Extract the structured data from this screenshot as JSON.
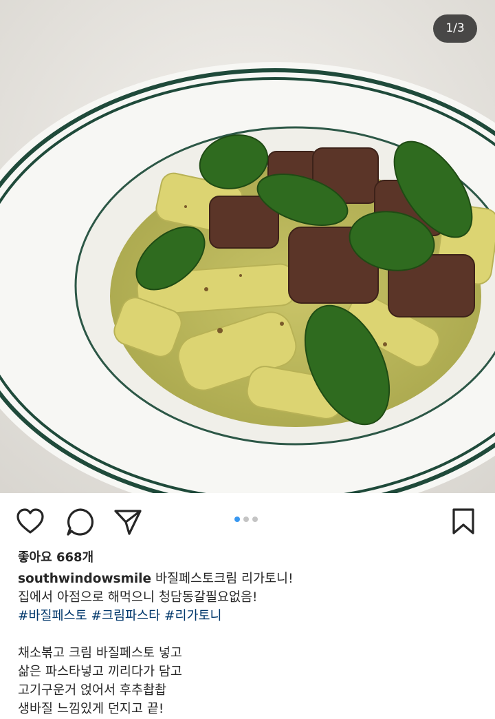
{
  "post": {
    "image_counter": "1/3",
    "image_alt": "바질페스토크림 리가토니 사진"
  },
  "carousel": {
    "count": 3,
    "active_index": 0
  },
  "likes": {
    "text": "좋아요 668개"
  },
  "caption": {
    "username": "southwindowsmile",
    "title": "바질페스토크림 리가토니!",
    "line2": "집에서 아점으로 해먹으니 청담동갈필요없음!",
    "hashtags": [
      "#바질페스토",
      "#크림파스타",
      "#리가토니"
    ],
    "body": [
      "채소볶고 크림 바질페스토 넣고",
      "삶은 파스타넣고 끼리다가 담고",
      "고기구운거 얹어서 후추촵촵",
      "생바질 느낌있게 던지고 끝!"
    ]
  },
  "icons": [
    "heart-icon",
    "comment-icon",
    "share-icon",
    "bookmark-icon"
  ],
  "colors": {
    "accent_dot": "#3897f0",
    "hashtag": "#00376b",
    "text": "#262626"
  }
}
